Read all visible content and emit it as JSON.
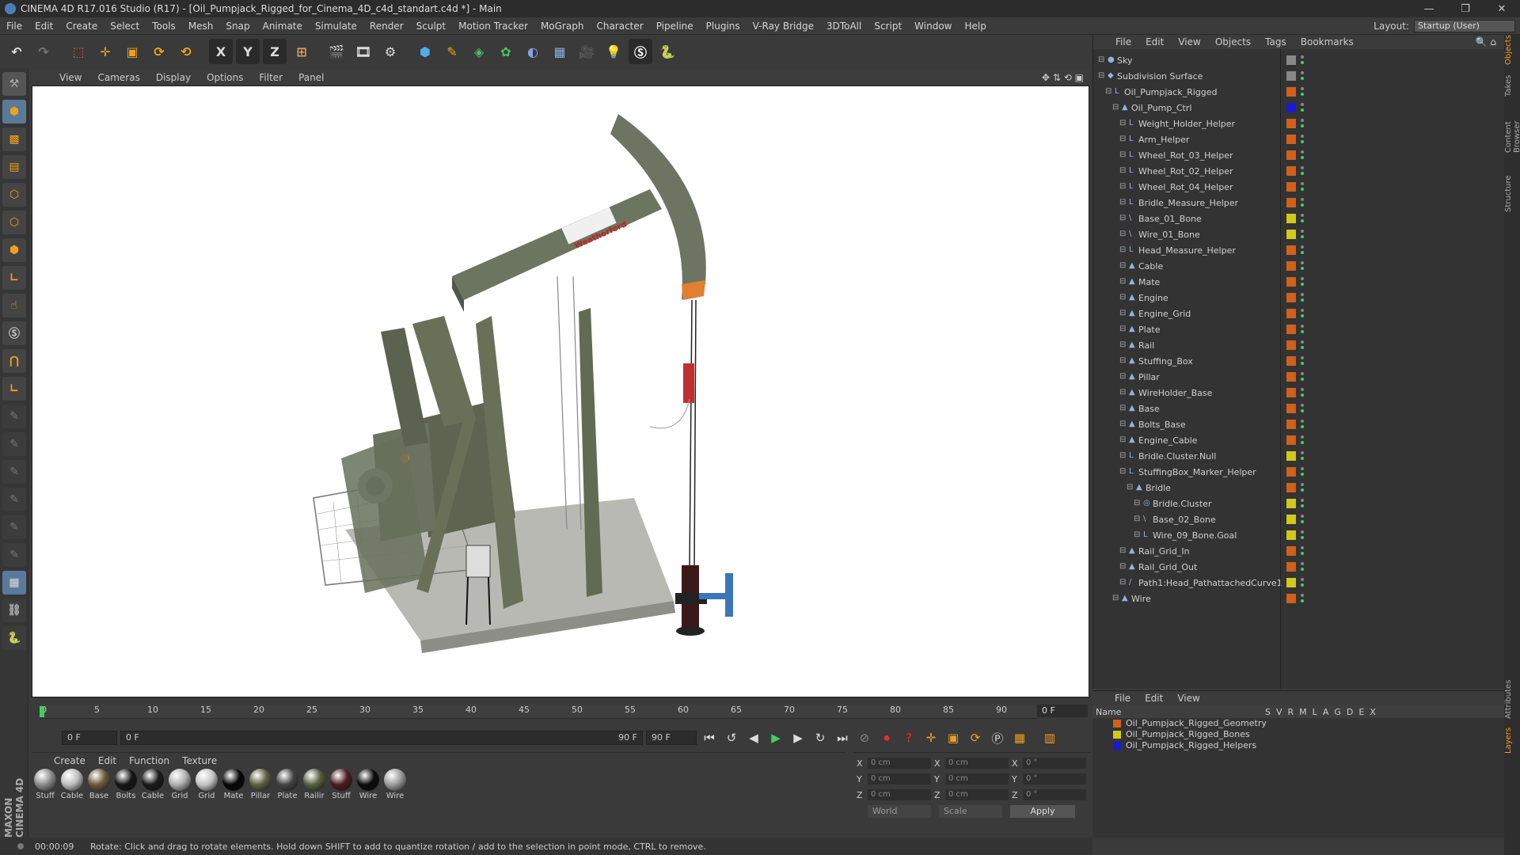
{
  "window": {
    "title": "CINEMA 4D R17.016 Studio (R17) - [Oil_Pumpjack_Rigged_for_Cinema_4D_c4d_standart.c4d *] - Main",
    "min": "—",
    "max": "❐",
    "close": "✕"
  },
  "menu": [
    "File",
    "Edit",
    "Create",
    "Select",
    "Tools",
    "Mesh",
    "Snap",
    "Animate",
    "Simulate",
    "Render",
    "Sculpt",
    "Motion Tracker",
    "MoGraph",
    "Character",
    "Pipeline",
    "Plugins",
    "V-Ray Bridge",
    "3DToAll",
    "Script",
    "Window",
    "Help"
  ],
  "layout": {
    "label": "Layout:",
    "value": "Startup (User)"
  },
  "toolbar": {
    "x_label": "X",
    "y_label": "Y",
    "z_label": "Z"
  },
  "viewport_menu": [
    "View",
    "Cameras",
    "Display",
    "Options",
    "Filter",
    "Panel"
  ],
  "viewport": {
    "brand_text": "Weatherford"
  },
  "timeline": {
    "ticks": [
      "0",
      "5",
      "10",
      "15",
      "20",
      "25",
      "30",
      "35",
      "40",
      "45",
      "50",
      "55",
      "60",
      "65",
      "70",
      "75",
      "80",
      "85",
      "90"
    ],
    "current_frame": "0 F",
    "start_field": "0 F",
    "slider_start": "0 F",
    "slider_end": "90 F",
    "end_field": "90 F"
  },
  "material_menu": [
    "Create",
    "Edit",
    "Function",
    "Texture"
  ],
  "materials": [
    {
      "label": "Stuff",
      "color": "#8c8c8c"
    },
    {
      "label": "Cable",
      "color": "#bdbdbd"
    },
    {
      "label": "Base",
      "color": "#6b5a3a"
    },
    {
      "label": "Bolts",
      "color": "#151515"
    },
    {
      "label": "Cable",
      "color": "#1a1a1a"
    },
    {
      "label": "Grid",
      "color": "#b0b0b0"
    },
    {
      "label": "Grid",
      "color": "#c4c4c4"
    },
    {
      "label": "Mate",
      "color": "#050505"
    },
    {
      "label": "Pillar",
      "color": "#5c5f45"
    },
    {
      "label": "Plate",
      "color": "#444"
    },
    {
      "label": "Railir",
      "color": "#56603f"
    },
    {
      "label": "Stuff",
      "color": "#4a1c22"
    },
    {
      "label": "Wire",
      "color": "#0a0a0a"
    },
    {
      "label": "Wire",
      "color": "#9a9a9a"
    }
  ],
  "coords": {
    "x": "X",
    "y": "Y",
    "z": "Z",
    "pos": "0 cm",
    "size": "0 cm",
    "rot": "0 °",
    "mode_world": "World",
    "mode_scale": "Scale",
    "apply": "Apply"
  },
  "status": {
    "time": "00:00:09",
    "message": "Rotate: Click and drag to rotate elements. Hold down SHIFT to add to quantize rotation / add to the selection in point mode, CTRL to remove."
  },
  "object_menu": [
    "File",
    "Edit",
    "View",
    "Objects",
    "Tags",
    "Bookmarks"
  ],
  "objects": [
    {
      "name": "Sky",
      "indent": 0,
      "color": "#888",
      "icon": "●"
    },
    {
      "name": "Subdivision Surface",
      "indent": 0,
      "color": "#888",
      "icon": "◆"
    },
    {
      "name": "Oil_Pumpjack_Rigged",
      "indent": 1,
      "color": "#d2601a",
      "icon": "L"
    },
    {
      "name": "Oil_Pump_Ctrl",
      "indent": 2,
      "color": "#1a1ad2",
      "icon": "▲"
    },
    {
      "name": "Weight_Holder_Helper",
      "indent": 3,
      "color": "#d2601a",
      "icon": "L"
    },
    {
      "name": "Arm_Helper",
      "indent": 3,
      "color": "#d2601a",
      "icon": "L"
    },
    {
      "name": "Wheel_Rot_03_Helper",
      "indent": 3,
      "color": "#d2601a",
      "icon": "L"
    },
    {
      "name": "Wheel_Rot_02_Helper",
      "indent": 3,
      "color": "#d2601a",
      "icon": "L"
    },
    {
      "name": "Wheel_Rot_04_Helper",
      "indent": 3,
      "color": "#d2601a",
      "icon": "L"
    },
    {
      "name": "Bridle_Measure_Helper",
      "indent": 3,
      "color": "#d2601a",
      "icon": "L"
    },
    {
      "name": "Base_01_Bone",
      "indent": 3,
      "color": "#d2c81a",
      "icon": "\\"
    },
    {
      "name": "Wire_01_Bone",
      "indent": 3,
      "color": "#d2c81a",
      "icon": "\\"
    },
    {
      "name": "Head_Measure_Helper",
      "indent": 3,
      "color": "#d2601a",
      "icon": "L"
    },
    {
      "name": "Cable",
      "indent": 3,
      "color": "#d2601a",
      "icon": "▲"
    },
    {
      "name": "Mate",
      "indent": 3,
      "color": "#d2601a",
      "icon": "▲"
    },
    {
      "name": "Engine",
      "indent": 3,
      "color": "#d2601a",
      "icon": "▲"
    },
    {
      "name": "Engine_Grid",
      "indent": 3,
      "color": "#d2601a",
      "icon": "▲"
    },
    {
      "name": "Plate",
      "indent": 3,
      "color": "#d2601a",
      "icon": "▲"
    },
    {
      "name": "Rail",
      "indent": 3,
      "color": "#d2601a",
      "icon": "▲"
    },
    {
      "name": "Stuffing_Box",
      "indent": 3,
      "color": "#d2601a",
      "icon": "▲"
    },
    {
      "name": "Pillar",
      "indent": 3,
      "color": "#d2601a",
      "icon": "▲"
    },
    {
      "name": "WireHolder_Base",
      "indent": 3,
      "color": "#d2601a",
      "icon": "▲"
    },
    {
      "name": "Base",
      "indent": 3,
      "color": "#d2601a",
      "icon": "▲"
    },
    {
      "name": "Bolts_Base",
      "indent": 3,
      "color": "#d2601a",
      "icon": "▲"
    },
    {
      "name": "Engine_Cable",
      "indent": 3,
      "color": "#d2601a",
      "icon": "▲"
    },
    {
      "name": "Bridle.Cluster.Null",
      "indent": 3,
      "color": "#d2c81a",
      "icon": "L"
    },
    {
      "name": "StuffingBox_Marker_Helper",
      "indent": 3,
      "color": "#d2601a",
      "icon": "L"
    },
    {
      "name": "Bridle",
      "indent": 4,
      "color": "#d2601a",
      "icon": "▲"
    },
    {
      "name": "Bridle.Cluster",
      "indent": 5,
      "color": "#d2c81a",
      "icon": "◎"
    },
    {
      "name": "Base_02_Bone",
      "indent": 5,
      "color": "#d2c81a",
      "icon": "\\"
    },
    {
      "name": "Wire_09_Bone.Goal",
      "indent": 5,
      "color": "#d2c81a",
      "icon": "L"
    },
    {
      "name": "Rail_Grid_In",
      "indent": 3,
      "color": "#d2601a",
      "icon": "▲"
    },
    {
      "name": "Rail_Grid_Out",
      "indent": 3,
      "color": "#d2601a",
      "icon": "▲"
    },
    {
      "name": "Path1:Head_PathattachedCurve1",
      "indent": 3,
      "color": "#d2c81a",
      "icon": "/"
    },
    {
      "name": "Wire",
      "indent": 2,
      "color": "#d2601a",
      "icon": "▲"
    }
  ],
  "layer_menu": [
    "File",
    "Edit",
    "View"
  ],
  "layer_head": {
    "name": "Name",
    "cols": [
      "S",
      "V",
      "R",
      "M",
      "L",
      "A",
      "G",
      "D",
      "E",
      "X"
    ]
  },
  "layers": [
    {
      "name": "Oil_Pumpjack_Rigged_Geometry",
      "color": "#d2601a"
    },
    {
      "name": "Oil_Pumpjack_Rigged_Bones",
      "color": "#d2c81a"
    },
    {
      "name": "Oil_Pumpjack_Rigged_Helpers",
      "color": "#1a1ad2"
    }
  ],
  "side_tabs": [
    "Objects",
    "Takes",
    "Content Browser",
    "Structure"
  ],
  "side_tabs_bottom": [
    "Attributes",
    "Layers"
  ],
  "brand": "MAXON CINEMA 4D"
}
